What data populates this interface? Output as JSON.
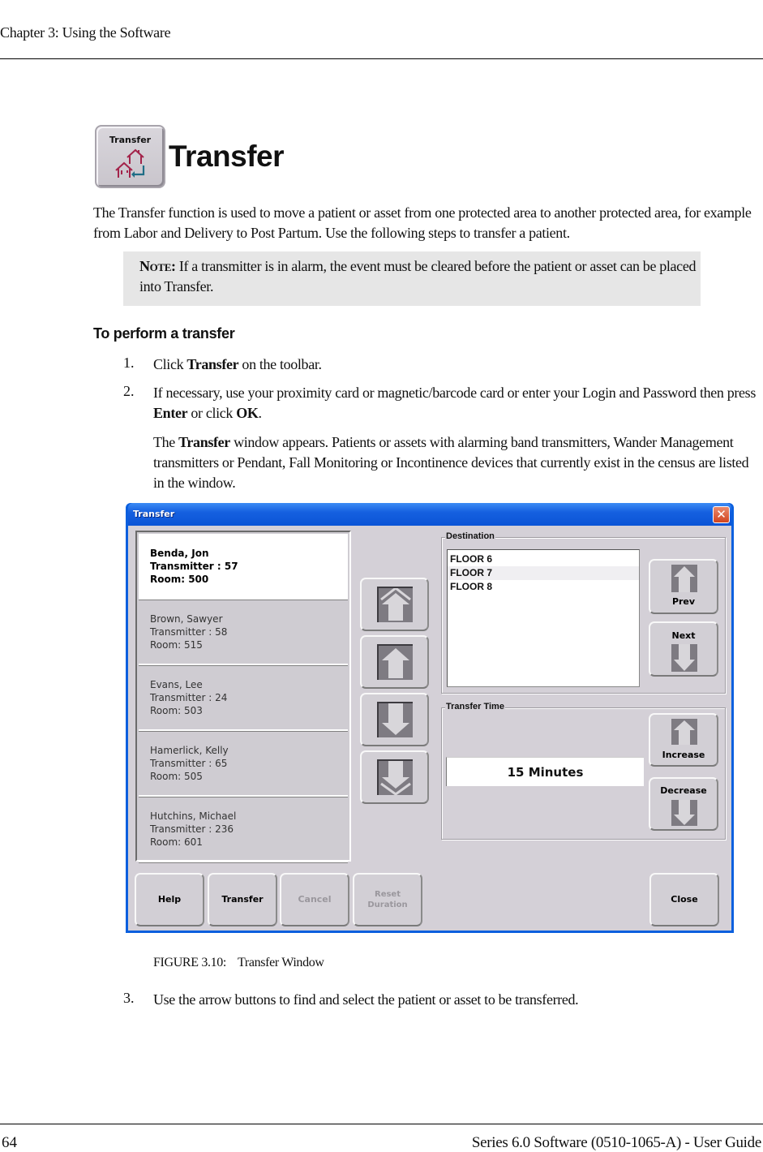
{
  "header": {
    "chapter": "Chapter 3: Using the Software"
  },
  "section": {
    "icon_label": "Transfer",
    "icon_name": "transfer-house-icon",
    "title": "Transfer"
  },
  "intro": "The Transfer function is used to move a patient or asset from one protected area to another protected area, for example from Labor and Delivery to Post Partum. Use the following steps to transfer a patient.",
  "note": {
    "label": "Note:",
    "text": " If a transmitter is in alarm, the event must be cleared before the patient or asset can be placed into Transfer."
  },
  "procedure": {
    "title": "To perform a transfer",
    "steps": [
      {
        "num": "1.",
        "pre": "Click ",
        "bold": "Transfer",
        "post": " on the toolbar."
      },
      {
        "num": "2.",
        "pre": "If necessary, use your proximity card or magnetic/barcode card or enter your Login and Password then press ",
        "bold": "Enter",
        "mid": " or click ",
        "bold2": "OK",
        "post": "."
      },
      {
        "pre": "The ",
        "bold": "Transfer",
        "post": " window appears. Patients or assets with alarming band transmitters, Wander Management transmitters or Pendant, Fall Monitoring or Incontinence devices that currently exist in the census are listed in the window."
      },
      {
        "num": "3.",
        "text": "Use the arrow buttons to find and select the patient or asset to be transferred."
      }
    ]
  },
  "figure": {
    "caption_num": "FIGURE 3.10:",
    "caption_text": "Transfer Window",
    "window": {
      "title": "Transfer",
      "close_glyph": "✕",
      "patients": [
        {
          "name": "Benda, Jon",
          "transmitter": "Transmitter : 57",
          "room": "Room: 500",
          "selected": true
        },
        {
          "name": "Brown, Sawyer",
          "transmitter": "Transmitter : 58",
          "room": "Room: 515",
          "selected": false
        },
        {
          "name": "Evans, Lee",
          "transmitter": "Transmitter : 24",
          "room": "Room: 503",
          "selected": false
        },
        {
          "name": "Hamerlick, Kelly",
          "transmitter": "Transmitter : 65",
          "room": "Room: 505",
          "selected": false
        },
        {
          "name": "Hutchins, Michael",
          "transmitter": "Transmitter : 236",
          "room": "Room: 601",
          "selected": false
        }
      ],
      "scroll_buttons": [
        "page-up",
        "up",
        "down",
        "page-down"
      ],
      "destination": {
        "legend": "Destination",
        "items": [
          "FLOOR 6",
          "FLOOR 7",
          "FLOOR 8"
        ],
        "highlighted": "FLOOR 7",
        "prev_label": "Prev",
        "next_label": "Next"
      },
      "transfer_time": {
        "legend": "Transfer Time",
        "value": "15 Minutes",
        "increase_label": "Increase",
        "decrease_label": "Decrease"
      },
      "buttons": {
        "help": "Help",
        "transfer": "Transfer",
        "cancel": "Cancel",
        "reset_line1": "Reset",
        "reset_line2": "Duration",
        "close": "Close"
      }
    }
  },
  "footer": {
    "page_number": "64",
    "title": "Series 6.0 Software (0510-1065-A) - User Guide"
  }
}
